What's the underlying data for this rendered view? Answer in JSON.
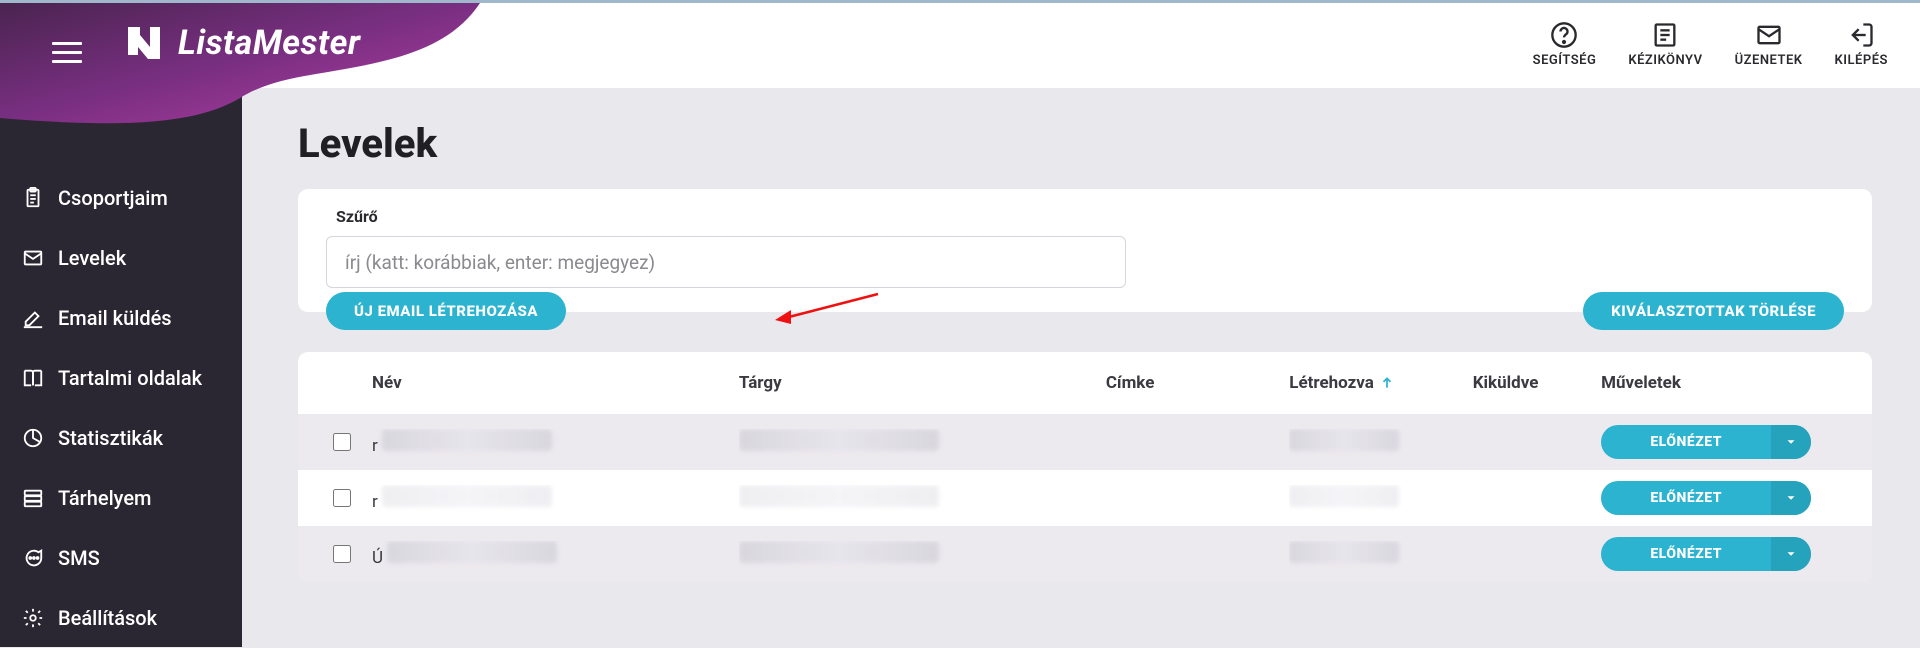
{
  "brand": {
    "name": "ListaMester"
  },
  "top_actions": {
    "help": "SEGÍTSÉG",
    "manual": "KÉZIKÖNYV",
    "messages": "ÜZENETEK",
    "logout": "KILÉPÉS"
  },
  "sidebar": {
    "items": [
      {
        "label": "Csoportjaim"
      },
      {
        "label": "Levelek"
      },
      {
        "label": "Email küldés"
      },
      {
        "label": "Tartalmi oldalak"
      },
      {
        "label": "Statisztikák"
      },
      {
        "label": "Tárhelyem"
      },
      {
        "label": "SMS"
      },
      {
        "label": "Beállítások"
      }
    ]
  },
  "page": {
    "title": "Levelek",
    "filter_label": "Szűrő",
    "filter_placeholder": "írj (katt: korábbiak, enter: megjegyez)",
    "new_email_button": "ÚJ EMAIL LÉTREHOZÁSA",
    "delete_selected_button": "KIVÁLASZTOTTAK TÖRLÉSE"
  },
  "table": {
    "headers": {
      "name": "Név",
      "subject": "Tárgy",
      "label": "Címke",
      "created": "Létrehozva",
      "sent": "Kiküldve",
      "actions": "Műveletek"
    },
    "action_label": "ELŐNÉZET",
    "rows": [
      {
        "name_prefix": "r"
      },
      {
        "name_prefix": "r"
      },
      {
        "name_prefix": "Ú"
      }
    ]
  },
  "colors": {
    "accent": "#2bb3cf",
    "sidebar": "#2a2732",
    "purple1": "#5f2e63",
    "purple2": "#9f3a9a"
  }
}
